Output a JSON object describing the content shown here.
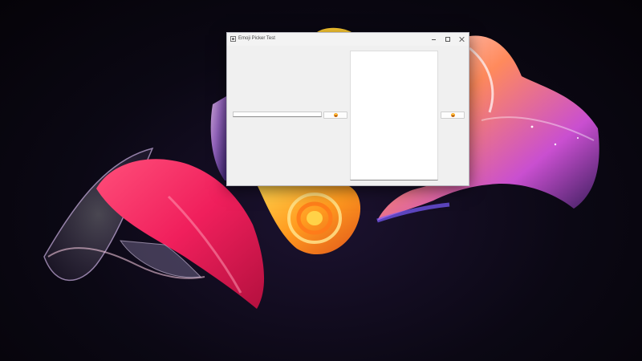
{
  "window": {
    "title": "Emoji Picker Test",
    "icon": "app-window-icon",
    "controls": {
      "minimize": "minimize-icon",
      "maximize": "maximize-icon",
      "close": "close-icon"
    }
  },
  "form": {
    "input_value": "",
    "text_area_value": "",
    "left_button_icon": "emoji-icon",
    "right_button_icon": "emoji-icon"
  },
  "colors": {
    "window_background": "#f0f0f0",
    "input_background": "#ffffff",
    "emoji_accent": "#f4900c"
  }
}
